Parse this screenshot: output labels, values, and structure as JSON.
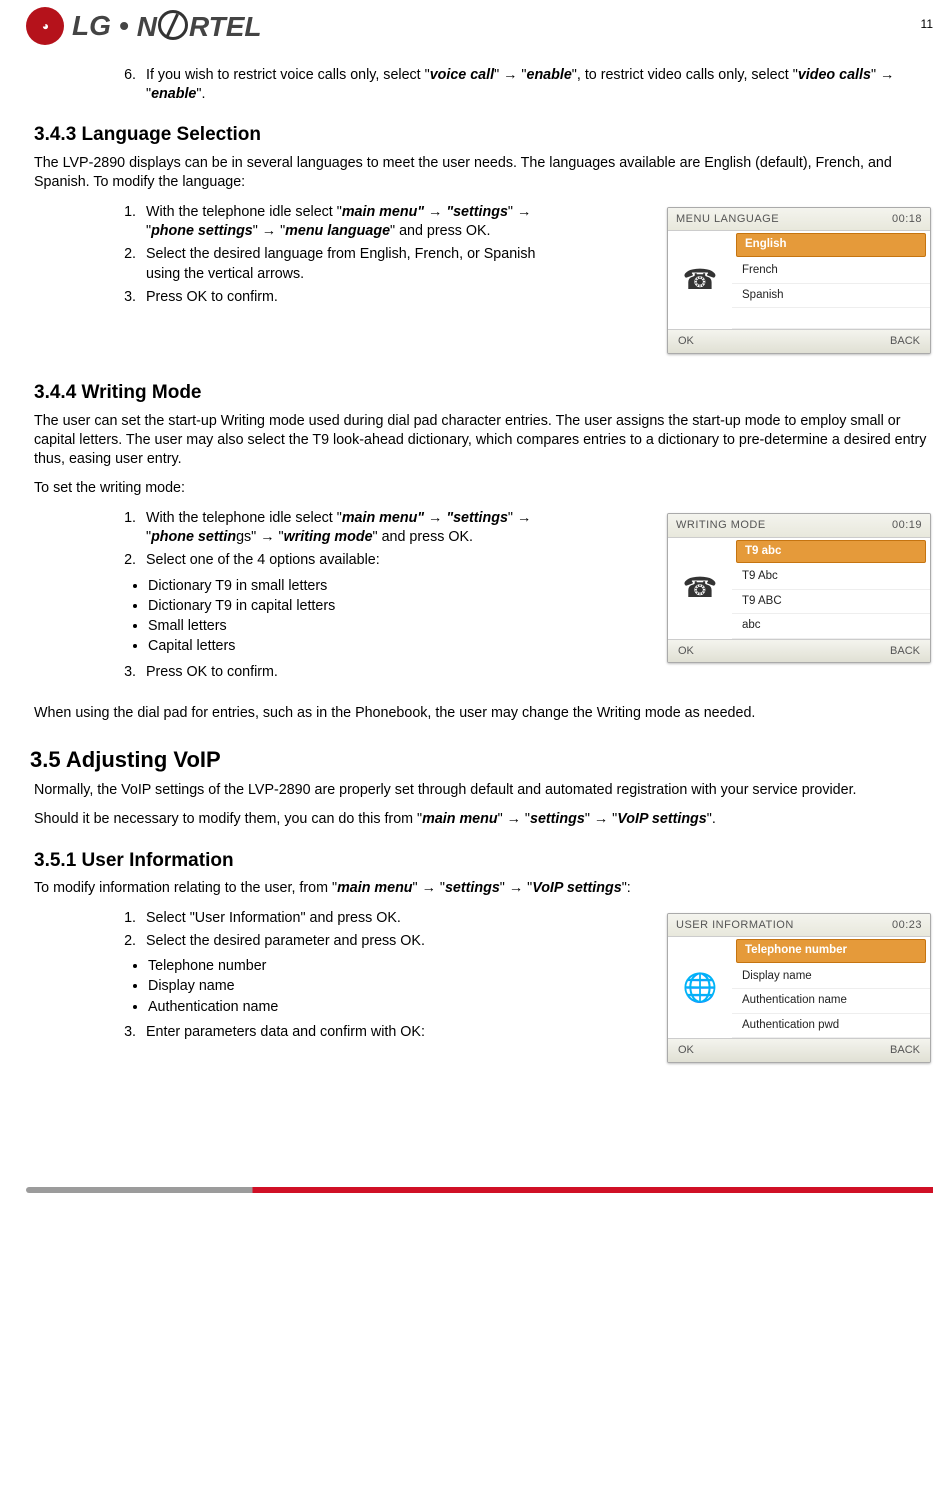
{
  "page_number": "11",
  "logo": {
    "lg": "LG",
    "dot": "•",
    "nortel_pre": "N",
    "nortel_post": "RTEL"
  },
  "item6_a": "If you wish to restrict voice calls only, select \"",
  "item6_b": "voice call",
  "item6_c": "\" → \"",
  "item6_d": "enable",
  "item6_e": "\", to restrict video calls only, select \"",
  "item6_f": "video calls",
  "item6_g": "\" → \"",
  "item6_h": "enable",
  "item6_i": "\".",
  "h343": "3.4.3    Language Selection",
  "p343": "The LVP-2890 displays can be in several languages to meet the user needs. The languages available are English (default), French, and Spanish. To modify the language:",
  "l343_1a": "With the telephone idle select \"",
  "l343_1b": "main menu\" → \"settings",
  "l343_1c": "\" → \"",
  "l343_1d": "phone settings",
  "l343_1e": "\" → \"",
  "l343_1f": "menu language",
  "l343_1g": "\" and press OK.",
  "l343_2": "Select the desired language from English, French, or Spanish using the vertical arrows.",
  "l343_3": "Press OK to confirm.",
  "shot1": {
    "title": "MENU LANGUAGE",
    "time": "00:18",
    "opts": [
      "English",
      "French",
      "Spanish"
    ],
    "soft_l": "OK",
    "soft_r": "BACK",
    "icon": "☎"
  },
  "h344": "3.4.4    Writing Mode",
  "p344": "The user can set the start-up Writing mode used during dial pad character entries.  The user assigns the start-up mode to employ small or capital letters. The user may also select the T9 look-ahead dictionary, which compares entries to a dictionary to pre-determine a desired entry thus, easing user entry.",
  "p344b": "To set the writing mode:",
  "l344_1a": "With the telephone idle select \"",
  "l344_1b": "main menu\" → \"settings",
  "l344_1c": "\" → \"",
  "l344_1d": "phone settin",
  "l344_1d2": "gs\" → \"",
  "l344_1e": "writing mode",
  "l344_1f": "\" and press OK.",
  "l344_2": "Select one of the 4 options available:",
  "l344_b1": "Dictionary T9 in small letters",
  "l344_b2": "Dictionary T9 in capital letters",
  "l344_b3": "Small letters",
  "l344_b4": "Capital letters",
  "l344_3": "Press OK to confirm.",
  "p344c": "When using the dial pad for entries, such as in the Phonebook, the user may change the Writing mode as needed.",
  "shot2": {
    "title": "WRITING MODE",
    "time": "00:19",
    "opts": [
      "T9 abc",
      "T9 Abc",
      "T9 ABC",
      "abc"
    ],
    "soft_l": "OK",
    "soft_r": "BACK",
    "icon": "☎"
  },
  "h35": "3.5    Adjusting VoIP",
  "p35a": "Normally, the VoIP settings of the LVP-2890 are properly set through default and automated registration with your service provider.",
  "p35b_a": "Should it be necessary to modify them, you can do this from \"",
  "p35b_b": "main menu",
  "p35b_c": "\" → \"",
  "p35b_d": "settings",
  "p35b_e": "\" → \"",
  "p35b_f": "VoIP settings",
  "p35b_g": "\".",
  "h351": "3.5.1    User Information",
  "p351_a": "To modify information relating to the user, from \"",
  "p351_b": "main menu",
  "p351_c": "\" → \"",
  "p351_d": "settings",
  "p351_e": "\" → \"",
  "p351_f": "VoIP settings",
  "p351_g": "\":",
  "l351_1": "Select \"User Information\" and press OK.",
  "l351_2": "Select the desired parameter and press OK.",
  "l351_b1": "Telephone number",
  "l351_b2": "Display name",
  "l351_b3": "Authentication name",
  "l351_3": "Enter parameters data and confirm with OK:",
  "shot3": {
    "title": "USER INFORMATION",
    "time": "00:23",
    "opts": [
      "Telephone number",
      "Display name",
      "Authentication name",
      "Authentication pwd"
    ],
    "soft_l": "OK",
    "soft_r": "BACK",
    "icon": "🌐"
  }
}
